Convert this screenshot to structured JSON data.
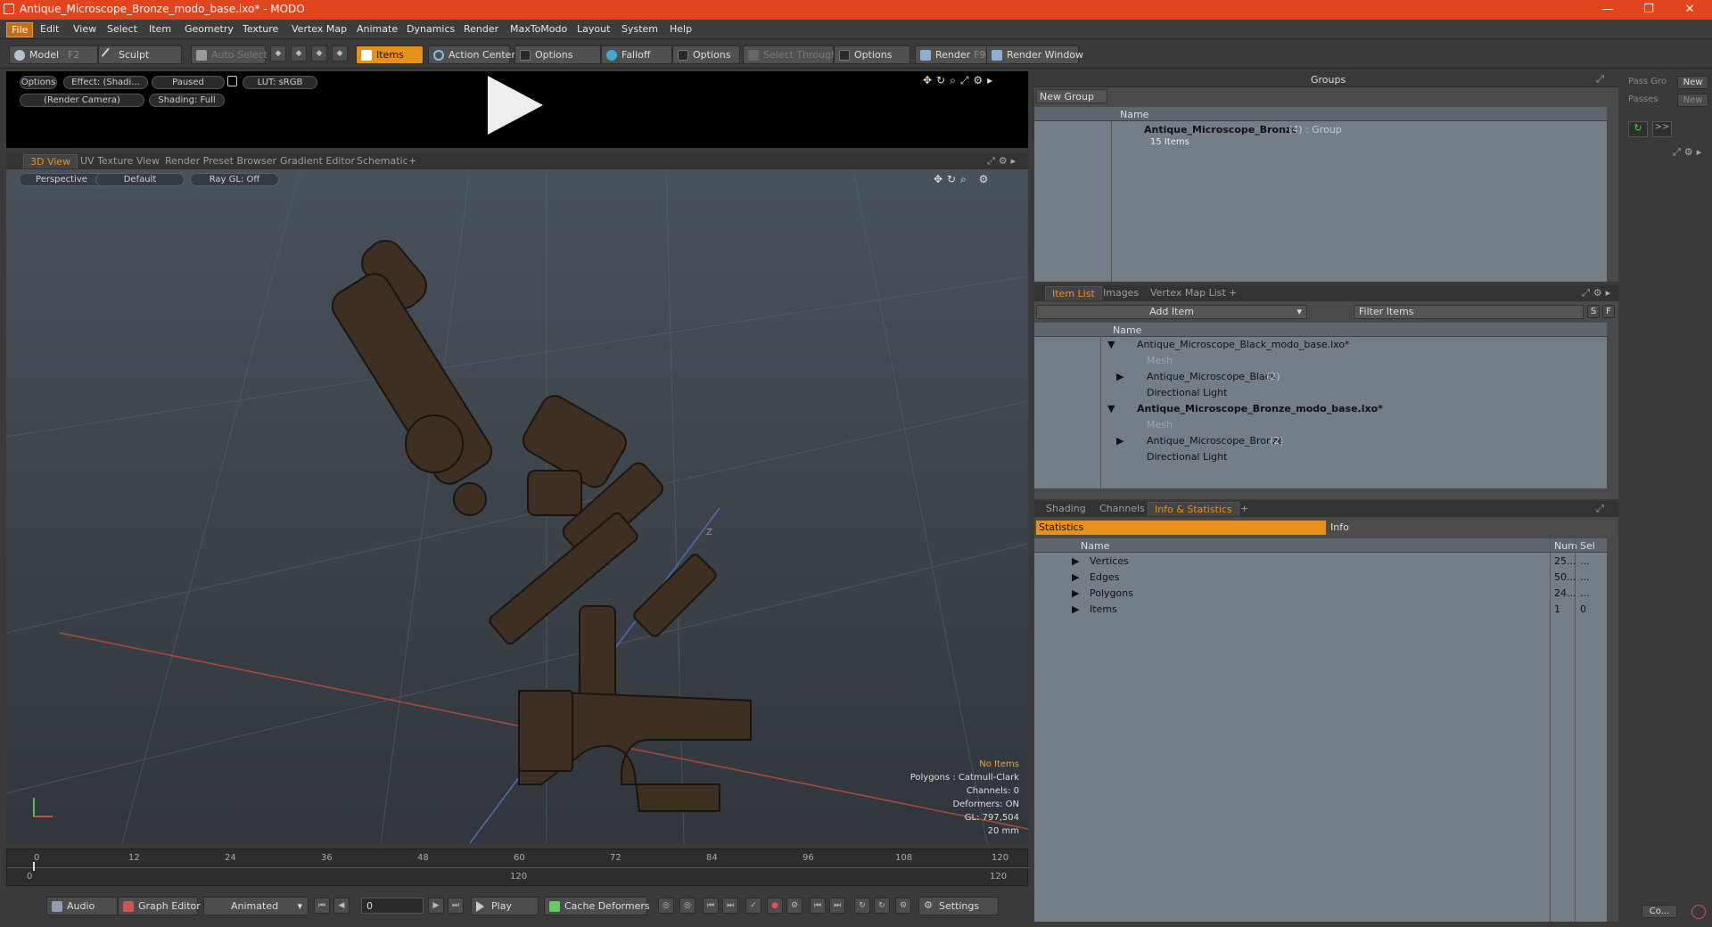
{
  "window": {
    "title": "Antique_Microscope_Bronze_modo_base.lxo* - MODO",
    "minimize": "—",
    "maximize": "❐",
    "close": "✕"
  },
  "menu": [
    "File",
    "Edit",
    "View",
    "Select",
    "Item",
    "Geometry",
    "Texture",
    "Vertex Map",
    "Animate",
    "Dynamics",
    "Render",
    "MaxToModo",
    "Layout",
    "System",
    "Help"
  ],
  "toolbar": {
    "model": "Model",
    "model_hotkey": "F2",
    "sculpt": "Sculpt",
    "auto_select": "Auto Select",
    "items": "Items",
    "action_center": "Action Center",
    "options1": "Options",
    "falloff": "Falloff",
    "options2": "Options",
    "select_through": "Select Through",
    "options3": "Options",
    "render": "Render",
    "render_hotkey": "F9",
    "render_window": "Render Window"
  },
  "preview": {
    "options": "Options",
    "effect": "Effect: (Shadi...",
    "paused": "Paused",
    "lut": "LUT: sRGB",
    "camera": "(Render Camera)",
    "shading": "Shading: Full"
  },
  "viewport_tabs": [
    "3D View",
    "UV Texture View",
    "Render Preset Browser",
    "Gradient Editor",
    "Schematic",
    "+"
  ],
  "viewport": {
    "perspective": "Perspective",
    "default": "Default",
    "raygl": "Ray GL: Off",
    "axis_label": "Z",
    "hud": {
      "no_items": "No Items",
      "polygons": "Polygons : Catmull-Clark",
      "channels": "Channels: 0",
      "deformers": "Deformers: ON",
      "gl": "GL: 797,504",
      "scale": "20 mm"
    }
  },
  "timeline": {
    "ticks": [
      "0",
      "12",
      "24",
      "36",
      "48",
      "60",
      "72",
      "84",
      "96",
      "108",
      "120"
    ],
    "range_start": "0",
    "range_mid": "120",
    "range_end": "120"
  },
  "bottom": {
    "audio": "Audio",
    "graph_editor": "Graph Editor",
    "animated": "Animated",
    "frame": "0",
    "play": "Play",
    "cache": "Cache Deformers",
    "settings": "Settings"
  },
  "groups": {
    "title": "Groups",
    "new_group": "New Group",
    "col_name": "Name",
    "item_name": "Antique_Microscope_Bronze",
    "item_suffix": "(4) : Group",
    "item_sub": "15 Items"
  },
  "item_list": {
    "tabs": [
      "Item List",
      "Images",
      "Vertex Map List",
      "+"
    ],
    "add_item": "Add Item",
    "filter": "Filter Items",
    "s": "S",
    "f": "F",
    "col_name": "Name",
    "rows": [
      {
        "text": "Antique_Microscope_Black_modo_base.lxo*",
        "extra": ""
      },
      {
        "text": "Mesh",
        "extra": ""
      },
      {
        "text": "Antique_Microscope_Black",
        "extra": "(2)"
      },
      {
        "text": "Directional Light",
        "extra": ""
      },
      {
        "text": "Antique_Microscope_Bronze_modo_base.lxo*",
        "extra": ""
      },
      {
        "text": "Mesh",
        "extra": ""
      },
      {
        "text": "Antique_Microscope_Bronze",
        "extra": "(2)"
      },
      {
        "text": "Directional Light",
        "extra": ""
      }
    ]
  },
  "stats": {
    "tabs": [
      "Shading",
      "Channels",
      "Info & Statistics",
      "+"
    ],
    "statistics": "Statistics",
    "info": "Info",
    "col_name": "Name",
    "col_num": "Num",
    "col_sel": "Sel",
    "rows": [
      {
        "name": "Vertices",
        "num": "25...",
        "sel": "..."
      },
      {
        "name": "Edges",
        "num": "50...",
        "sel": "..."
      },
      {
        "name": "Polygons",
        "num": "24...",
        "sel": "..."
      },
      {
        "name": "Items",
        "num": "1",
        "sel": "0"
      }
    ]
  },
  "side": {
    "pass_group": "Pass Gro",
    "new1": "New",
    "passes": "Passes",
    "new2": "New",
    "co": "Co..."
  }
}
